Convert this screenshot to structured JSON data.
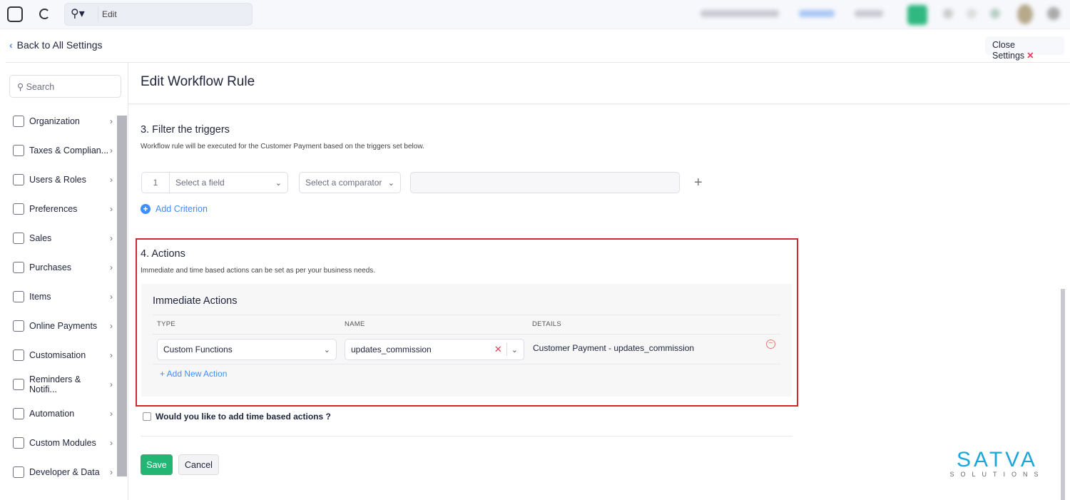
{
  "topbar": {
    "search_value": "Edit"
  },
  "nav": {
    "back_label": "Back to All Settings",
    "close_label": "Close Settings"
  },
  "sidebar": {
    "search_placeholder": "Search",
    "items": [
      {
        "label": "Organization",
        "icon": "building-icon"
      },
      {
        "label": "Taxes & Complian...",
        "icon": "tax-icon"
      },
      {
        "label": "Users & Roles",
        "icon": "users-icon"
      },
      {
        "label": "Preferences",
        "icon": "preferences-icon"
      },
      {
        "label": "Sales",
        "icon": "cart-icon"
      },
      {
        "label": "Purchases",
        "icon": "bag-icon"
      },
      {
        "label": "Items",
        "icon": "box-icon"
      },
      {
        "label": "Online Payments",
        "icon": "card-icon"
      },
      {
        "label": "Customisation",
        "icon": "brush-icon"
      },
      {
        "label": "Reminders & Notifi...",
        "icon": "bell-icon"
      },
      {
        "label": "Automation",
        "icon": "bolt-icon"
      },
      {
        "label": "Custom Modules",
        "icon": "modules-icon"
      },
      {
        "label": "Developer & Data",
        "icon": "terminal-icon"
      }
    ]
  },
  "page": {
    "title": "Edit Workflow Rule"
  },
  "filter": {
    "heading": "3. Filter the triggers",
    "subtitle": "Workflow rule will be executed for the Customer Payment based on the triggers set below.",
    "row_number": "1",
    "field_placeholder": "Select a field",
    "comparator_placeholder": "Select a comparator",
    "add_criterion": "Add Criterion"
  },
  "actions": {
    "heading": "4. Actions",
    "subtitle": "Immediate and time based actions can be set as per your business needs.",
    "immediate_heading": "Immediate Actions",
    "columns": [
      "TYPE",
      "NAME",
      "DETAILS"
    ],
    "rows": [
      {
        "type": "Custom Functions",
        "name": "updates_commission",
        "details": "Customer Payment - updates_commission"
      }
    ],
    "add_new": "+ Add New Action",
    "time_based_label": "Would you like to add time based actions ?",
    "time_based_checked": false
  },
  "buttons": {
    "save": "Save",
    "cancel": "Cancel"
  },
  "colors": {
    "accent": "#408dfb",
    "save": "#22b573",
    "highlight": "#d5262b"
  },
  "logo": {
    "name": "SATVA",
    "tagline": "SOLUTIONS"
  }
}
